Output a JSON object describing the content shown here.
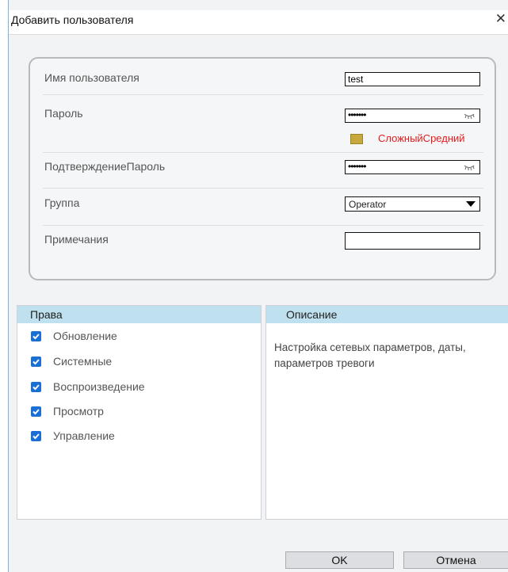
{
  "dialog": {
    "title": "Добавить пользователя",
    "close_symbol": "✕"
  },
  "form": {
    "username_label": "Имя пользователя",
    "username_value": "test",
    "password_label": "Пароль",
    "password_value": "•••••••",
    "strength_text": "СложныйСредний",
    "confirm_label": "ПодтверждениеПароль",
    "confirm_value": "•••••••",
    "group_label": "Группа",
    "group_value": "Operator",
    "notes_label": "Примечания",
    "notes_value": ""
  },
  "rights": {
    "header": "Права",
    "items": [
      {
        "label": "Обновление",
        "checked": true
      },
      {
        "label": "Системные",
        "checked": true
      },
      {
        "label": "Воспроизведение",
        "checked": true
      },
      {
        "label": "Просмотр",
        "checked": true
      },
      {
        "label": "Управление",
        "checked": true
      }
    ]
  },
  "description": {
    "header": "Описание",
    "text": "Настройка сетевых параметров, даты, параметров тревоги"
  },
  "buttons": {
    "ok": "OK",
    "cancel": "Отмена"
  },
  "colors": {
    "header_bg": "#bfe0ef",
    "checkbox": "#1a6fd6",
    "strength_text": "#e31b1b",
    "strength_indicator": "#c7a83c"
  },
  "icons": {
    "close": "close-icon",
    "eye": "eye-off-icon",
    "dropdown": "chevron-down-icon",
    "checkbox": "checkbox-checked-icon"
  }
}
